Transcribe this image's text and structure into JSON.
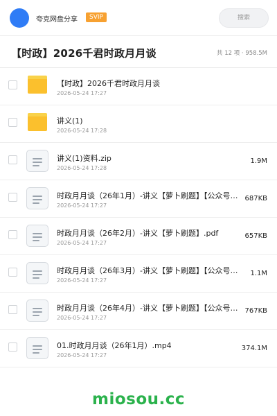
{
  "topbar": {
    "username": "夸克网盘分享",
    "badge": "SVIP",
    "search_placeholder": "搜索"
  },
  "folder": {
    "title": "【时政】2026千君时政月月谈",
    "meta": "共 12 项 · 958.5M"
  },
  "files": [
    {
      "name": "【时政】2026千君时政月月谈",
      "date": "2026-05-24 17:27",
      "size": "",
      "type": "folder"
    },
    {
      "name": "讲义(1)",
      "date": "2026-05-24 17:28",
      "size": "",
      "type": "folder"
    },
    {
      "name": "讲义(1)资料.zip",
      "date": "2026-05-24 17:28",
      "size": "1.9M",
      "type": "file"
    },
    {
      "name": "时政月月谈（26年1月）-讲义【萝卜刷题】【公众号…",
      "date": "2026-05-24 17:27",
      "size": "687KB",
      "type": "file"
    },
    {
      "name": "时政月月谈（26年2月）-讲义【萝卜刷题】.pdf",
      "date": "2026-05-24 17:27",
      "size": "657KB",
      "type": "file"
    },
    {
      "name": "时政月月谈（26年3月）-讲义【萝卜刷题】【公众号…",
      "date": "2026-05-24 17:27",
      "size": "1.1M",
      "type": "file"
    },
    {
      "name": "时政月月谈（26年4月）-讲义【萝卜刷题】【公众号…",
      "date": "2026-05-24 17:27",
      "size": "767KB",
      "type": "file"
    },
    {
      "name": "01.时政月月谈（26年1月）.mp4",
      "date": "2026-05-24 17:27",
      "size": "374.1M",
      "type": "file"
    }
  ],
  "footer": {
    "brand": "miosou.cc"
  },
  "colors": {
    "avatar": "#2f7cf6",
    "badge": "#f7a131",
    "folder": "#fbc02d",
    "brand": "#2bb24c"
  }
}
